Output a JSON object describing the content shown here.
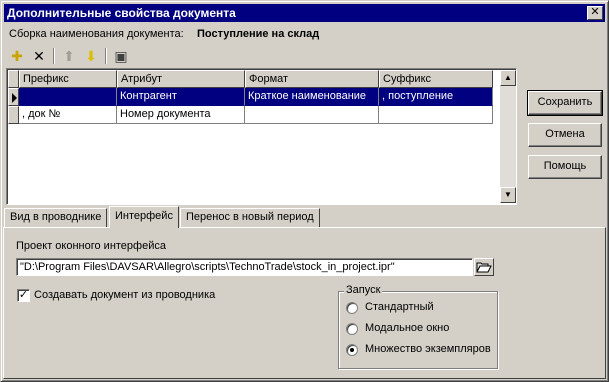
{
  "window": {
    "title": "Дополнительные свойства документа",
    "close_symbol": "✕"
  },
  "assembly": {
    "label": "Сборка наименования документа:",
    "value": "Поступление на склад"
  },
  "toolbar": {
    "add_icon": "✚",
    "delete_icon": "✕",
    "up_icon": "⬆",
    "down_icon": "⬇",
    "properties_icon": "▣"
  },
  "grid": {
    "columns": [
      "Префикс",
      "Атрибут",
      "Формат",
      "Суффикс"
    ],
    "rows": [
      {
        "prefix": "",
        "attribute": "Контрагент",
        "format": "Краткое наименование",
        "suffix": ", поступление"
      },
      {
        "prefix": ", док №",
        "attribute": "Номер документа",
        "format": "",
        "suffix": ""
      }
    ]
  },
  "buttons": {
    "save": "Сохранить",
    "cancel": "Отмена",
    "help": "Помощь"
  },
  "tabs": [
    "Вид в проводнике",
    "Интерфейс",
    "Перенос в новый период"
  ],
  "interface": {
    "project_label": "Проект оконного интерфейса",
    "project_path": "\"D:\\Program Files\\DAVSAR\\Allegro\\scripts\\TechnoTrade\\stock_in_project.ipr\"",
    "create_doc_label": "Создавать документ из проводника",
    "create_doc_checked": true,
    "launch_group": "Запуск",
    "launch_options": [
      "Стандартный",
      "Модальное окно",
      "Множество экземпляров"
    ],
    "launch_selected": 2
  }
}
